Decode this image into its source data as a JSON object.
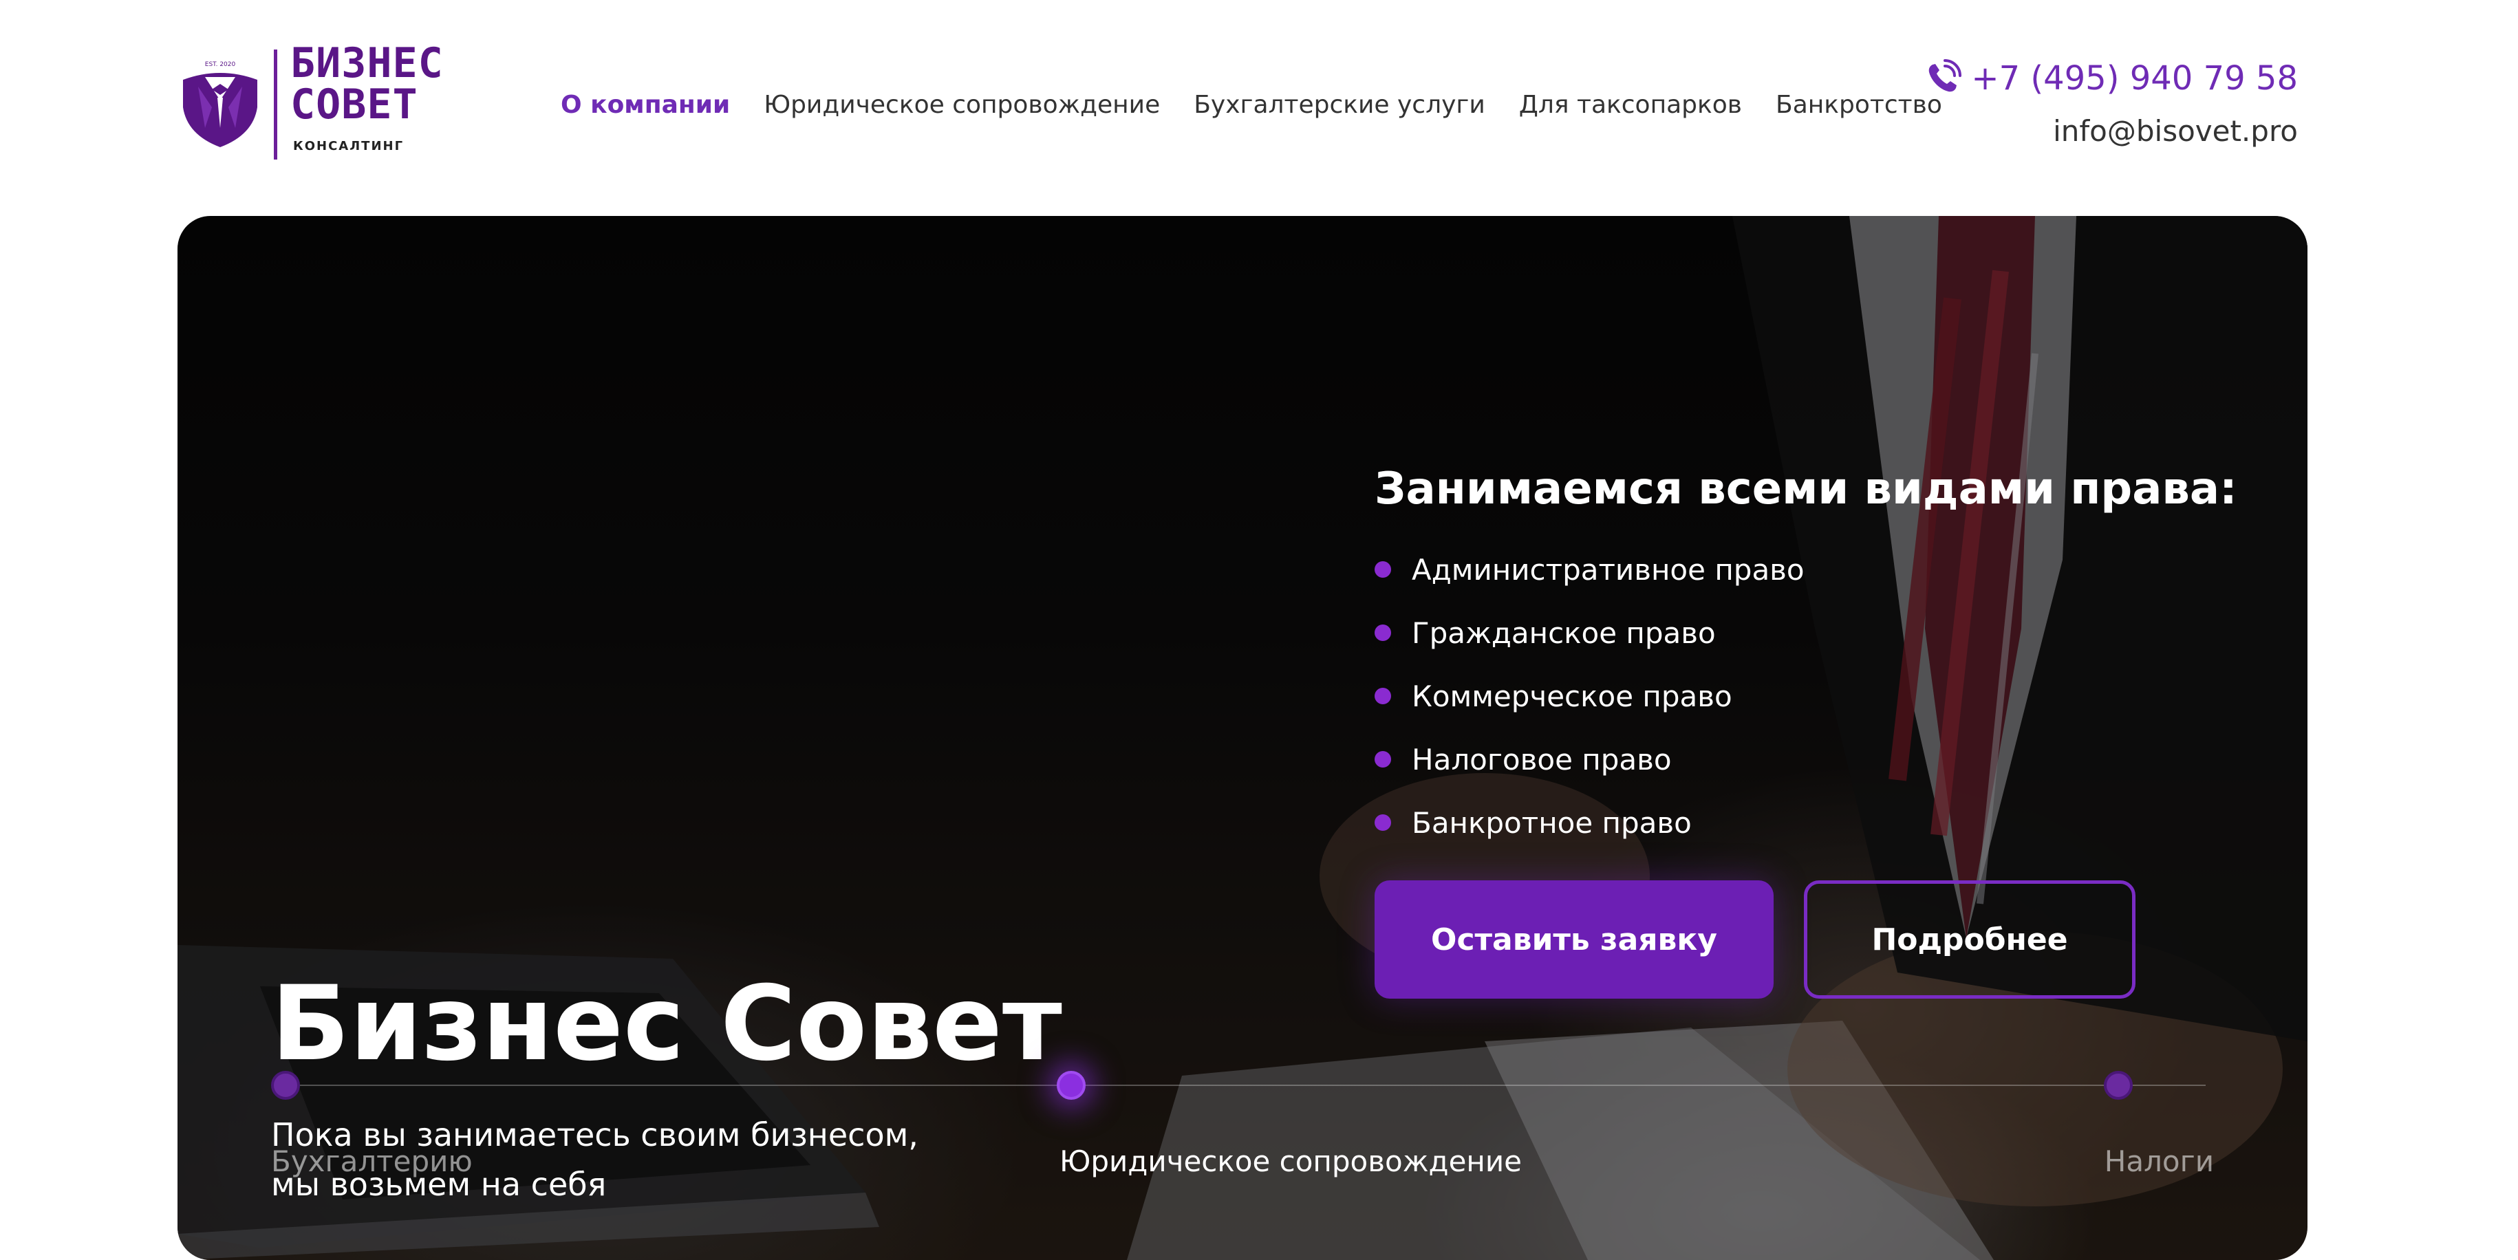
{
  "header": {
    "logo": {
      "est": "EST. 2020",
      "title_line1": "БИЗНЕС",
      "title_line2": "СОВЕТ",
      "subtitle": "КОНСАЛТИНГ"
    },
    "nav": [
      {
        "label": "О компании",
        "active": true
      },
      {
        "label": "Юридическое сопровождение",
        "active": false
      },
      {
        "label": "Бухгалтерские услуги",
        "active": false
      },
      {
        "label": "Для таксопарков",
        "active": false
      },
      {
        "label": "Банкротство",
        "active": false
      }
    ],
    "phone": "+7 (495) 940 79 58",
    "phone_icon": "phone-icon",
    "email": "info@bisovet.pro"
  },
  "hero": {
    "title": "Бизнес Совет",
    "subtitle_line1": "Пока вы занимаетесь своим бизнесом,",
    "subtitle_line2": "мы возьмем на себя",
    "services_title": "Занимаемся всеми видами права:",
    "services": [
      "Административное право",
      "Гражданское право",
      "Коммерческое право",
      "Налоговое право",
      "Банкротное право"
    ],
    "primary_button": "Оставить заявку",
    "secondary_button": "Подробнее",
    "timeline": [
      {
        "label": "Бухгалтерию",
        "active": false
      },
      {
        "label": "Юридическое сопровождение",
        "active": true
      },
      {
        "label": "Налоги",
        "active": false
      }
    ]
  },
  "colors": {
    "accent": "#6f2bb5",
    "button": "#6c1fb4",
    "bullet": "#8a2bd0"
  }
}
